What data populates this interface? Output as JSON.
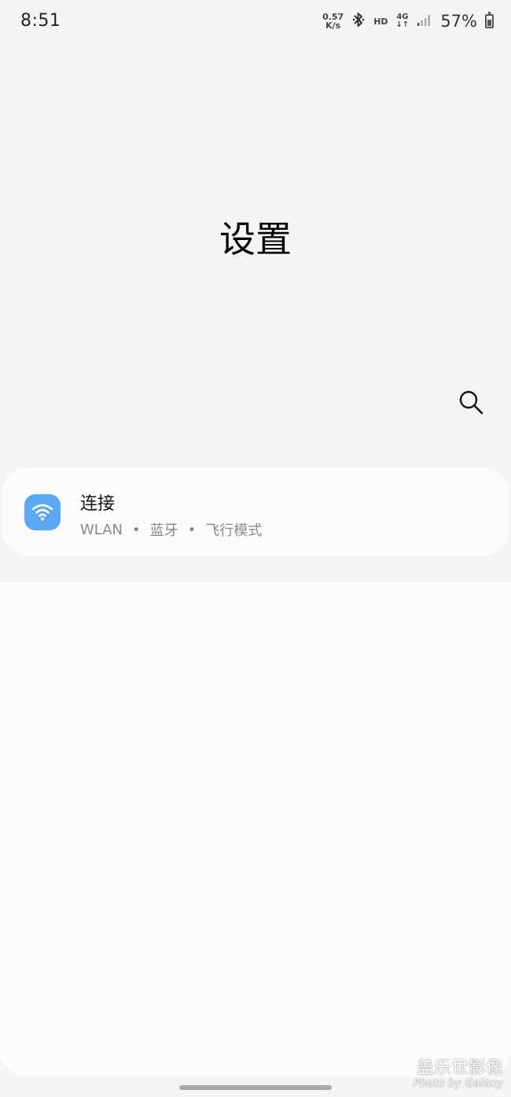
{
  "status_bar": {
    "time": "8:51",
    "net_speed_value": "0.57",
    "net_speed_unit": "K/s",
    "bluetooth_icon": "bluetooth-icon",
    "hd_label": "HD",
    "network_type": "4G",
    "signal_icon": "signal-icon",
    "battery_percent": "57%"
  },
  "page": {
    "title": "设置"
  },
  "search": {
    "icon": "search-icon"
  },
  "connections_card": {
    "icon": "wifi-icon",
    "icon_color": "#5aa7f4",
    "title": "连接",
    "subtitle_items": [
      "WLAN",
      "蓝牙",
      "飞行模式"
    ]
  },
  "watermark": {
    "main": "盖乐世影像",
    "sub": "Photo by Galaxy"
  }
}
